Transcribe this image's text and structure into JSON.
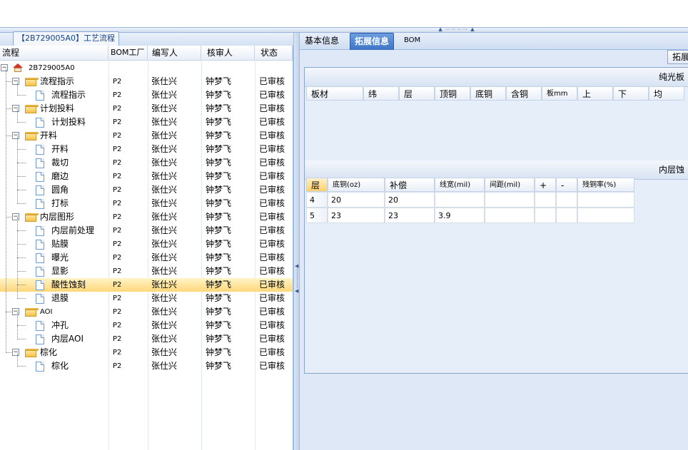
{
  "left_panel": {
    "title": "【2B729005A0】工艺流程",
    "columns": [
      "流程",
      "BOM工厂",
      "编写人",
      "核审人",
      "状态"
    ],
    "rows": [
      {
        "label": "2B729005A0",
        "level": 0,
        "icon": "home-icon",
        "bom": "",
        "writer": "",
        "reviewer": "",
        "status": ""
      },
      {
        "label": "流程指示",
        "level": 1,
        "icon": "folder-icon",
        "bom": "P2",
        "writer": "张仕兴",
        "reviewer": "钟梦飞",
        "status": "已审核"
      },
      {
        "label": "流程指示",
        "level": 2,
        "icon": "document-icon",
        "bom": "P2",
        "writer": "张仕兴",
        "reviewer": "钟梦飞",
        "status": "已审核"
      },
      {
        "label": "计划投料",
        "level": 1,
        "icon": "folder-icon",
        "bom": "P2",
        "writer": "张仕兴",
        "reviewer": "钟梦飞",
        "status": "已审核"
      },
      {
        "label": "计划投料",
        "level": 2,
        "icon": "document-icon",
        "bom": "P2",
        "writer": "张仕兴",
        "reviewer": "钟梦飞",
        "status": "已审核"
      },
      {
        "label": "开料",
        "level": 1,
        "icon": "folder-icon",
        "bom": "P2",
        "writer": "张仕兴",
        "reviewer": "钟梦飞",
        "status": "已审核"
      },
      {
        "label": "开料",
        "level": 2,
        "icon": "document-icon",
        "bom": "P2",
        "writer": "张仕兴",
        "reviewer": "钟梦飞",
        "status": "已审核"
      },
      {
        "label": "裁切",
        "level": 2,
        "icon": "document-icon",
        "bom": "P2",
        "writer": "张仕兴",
        "reviewer": "钟梦飞",
        "status": "已审核"
      },
      {
        "label": "磨边",
        "level": 2,
        "icon": "document-icon",
        "bom": "P2",
        "writer": "张仕兴",
        "reviewer": "钟梦飞",
        "status": "已审核"
      },
      {
        "label": "圆角",
        "level": 2,
        "icon": "document-icon",
        "bom": "P2",
        "writer": "张仕兴",
        "reviewer": "钟梦飞",
        "status": "已审核"
      },
      {
        "label": "打标",
        "level": 2,
        "icon": "document-icon",
        "bom": "P2",
        "writer": "张仕兴",
        "reviewer": "钟梦飞",
        "status": "已审核"
      },
      {
        "label": "内层图形",
        "level": 1,
        "icon": "folder-icon",
        "bom": "P2",
        "writer": "张仕兴",
        "reviewer": "钟梦飞",
        "status": "已审核"
      },
      {
        "label": "内层前处理",
        "level": 2,
        "icon": "document-icon",
        "bom": "P2",
        "writer": "张仕兴",
        "reviewer": "钟梦飞",
        "status": "已审核"
      },
      {
        "label": "贴膜",
        "level": 2,
        "icon": "document-icon",
        "bom": "P2",
        "writer": "张仕兴",
        "reviewer": "钟梦飞",
        "status": "已审核"
      },
      {
        "label": "曝光",
        "level": 2,
        "icon": "document-icon",
        "bom": "P2",
        "writer": "张仕兴",
        "reviewer": "钟梦飞",
        "status": "已审核"
      },
      {
        "label": "显影",
        "level": 2,
        "icon": "document-icon",
        "bom": "P2",
        "writer": "张仕兴",
        "reviewer": "钟梦飞",
        "status": "已审核"
      },
      {
        "label": "酸性蚀刻",
        "level": 2,
        "icon": "document-icon",
        "bom": "P2",
        "writer": "张仕兴",
        "reviewer": "钟梦飞",
        "status": "已审核",
        "selected": true
      },
      {
        "label": "退膜",
        "level": 2,
        "icon": "document-icon",
        "bom": "P2",
        "writer": "张仕兴",
        "reviewer": "钟梦飞",
        "status": "已审核"
      },
      {
        "label": "AOI",
        "level": 1,
        "icon": "folder-icon",
        "bom": "P2",
        "writer": "张仕兴",
        "reviewer": "钟梦飞",
        "status": "已审核"
      },
      {
        "label": "冲孔",
        "level": 2,
        "icon": "document-icon",
        "bom": "P2",
        "writer": "张仕兴",
        "reviewer": "钟梦飞",
        "status": "已审核"
      },
      {
        "label": "内层AOI",
        "level": 2,
        "icon": "document-icon",
        "bom": "P2",
        "writer": "张仕兴",
        "reviewer": "钟梦飞",
        "status": "已审核"
      },
      {
        "label": "棕化",
        "level": 1,
        "icon": "folder-icon",
        "bom": "P2",
        "writer": "张仕兴",
        "reviewer": "钟梦飞",
        "status": "已审核"
      },
      {
        "label": "棕化",
        "level": 2,
        "icon": "document-icon",
        "bom": "P2",
        "writer": "张仕兴",
        "reviewer": "钟梦飞",
        "status": "已审核"
      }
    ]
  },
  "right_panel": {
    "tabs": [
      {
        "label": "基本信息",
        "active": false
      },
      {
        "label": "拓展信息",
        "active": true
      },
      {
        "label": "BOM",
        "active": false
      }
    ],
    "expand_button": "拓展",
    "section1": {
      "title": "纯光板",
      "columns": [
        "板材",
        "纬",
        "层",
        "顶铜",
        "底铜",
        "含铜",
        "板mm",
        "上",
        "下",
        "均"
      ]
    },
    "section2": {
      "title": "内层蚀",
      "columns": [
        "层",
        "底铜(oz)",
        "补偿",
        "线宽(mil)",
        "间距(mil)",
        "+",
        "-",
        "残铜率(%)"
      ],
      "rows": [
        [
          "4",
          "20",
          "20",
          "",
          "",
          "",
          "",
          ""
        ],
        [
          "5",
          "23",
          "23",
          "3.9",
          "",
          "",
          "",
          ""
        ]
      ]
    }
  },
  "colors": {
    "accent": "#3e74c4",
    "selection": "#ffd77a",
    "panel_bg": "#dfe8f6",
    "border": "#99bbe8"
  }
}
